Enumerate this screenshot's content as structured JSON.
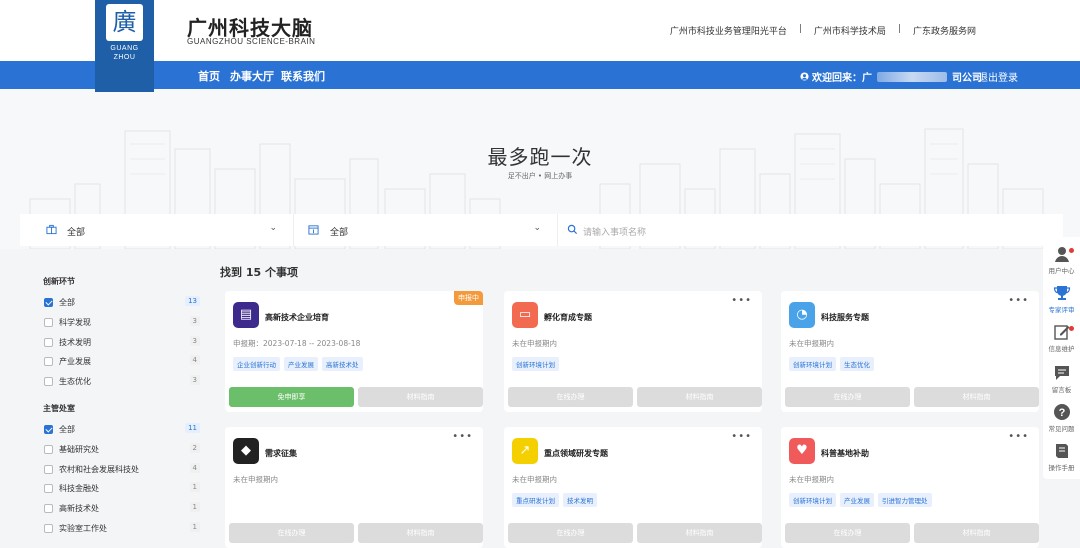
{
  "brand": {
    "logo_char": "廣",
    "logo_en_1": "GUANG",
    "logo_en_2": "ZHOU",
    "title": "广州科技大脑",
    "subtitle": "GUANGZHOU SCIENCE-BRAIN"
  },
  "top_links": [
    "广州市科技业务管理阳光平台",
    "广州市科学技术局",
    "广东政务服务网"
  ],
  "nav": {
    "items": [
      "首页",
      "办事大厅",
      "联系我们"
    ],
    "welcome_prefix": "欢迎回来：广",
    "welcome_suffix": "司公司",
    "logout": "退出登录"
  },
  "hero": {
    "title": "最多跑一次",
    "subtitle": "足不出户 • 网上办事"
  },
  "filters": {
    "category_value": "全部",
    "date_value": "全部",
    "search_placeholder": "请输入事项名称"
  },
  "sidebar": {
    "group1": {
      "title": "创新环节",
      "items": [
        {
          "label": "全部",
          "count": "13",
          "checked": true
        },
        {
          "label": "科学发现",
          "count": "3",
          "checked": false
        },
        {
          "label": "技术发明",
          "count": "3",
          "checked": false
        },
        {
          "label": "产业发展",
          "count": "4",
          "checked": false
        },
        {
          "label": "生态优化",
          "count": "3",
          "checked": false
        }
      ]
    },
    "group2": {
      "title": "主管处室",
      "items": [
        {
          "label": "全部",
          "count": "11",
          "checked": true
        },
        {
          "label": "基础研究处",
          "count": "2",
          "checked": false
        },
        {
          "label": "农村和社会发展科技处",
          "count": "4",
          "checked": false
        },
        {
          "label": "科技金融处",
          "count": "1",
          "checked": false
        },
        {
          "label": "高新技术处",
          "count": "1",
          "checked": false
        },
        {
          "label": "实验室工作处",
          "count": "1",
          "checked": false
        }
      ]
    }
  },
  "results": {
    "text": "找到 15 个事项"
  },
  "cards": [
    {
      "title": "高新技术企业培育",
      "period": "申报期：2023-07-18 -- 2023-08-18",
      "tags": [
        "企业创新行动",
        "产业发展",
        "高新技术处"
      ],
      "btn_left": "免申即享",
      "btn_right": "材料指南",
      "badge": "申报中",
      "icon_color": "#3d2a8c"
    },
    {
      "title": "孵化育成专题",
      "period": "未在申报期内",
      "tags": [
        "创新环境计划"
      ],
      "btn_left": "在线办理",
      "btn_right": "材料指南",
      "badge": "",
      "icon_color": "#f26a4f"
    },
    {
      "title": "科技服务专题",
      "period": "未在申报期内",
      "tags": [
        "创新环境计划",
        "生态优化"
      ],
      "btn_left": "在线办理",
      "btn_right": "材料指南",
      "badge": "",
      "icon_color": "#4aa3e8"
    },
    {
      "title": "需求征集",
      "period": "未在申报期内",
      "tags": [],
      "btn_left": "在线办理",
      "btn_right": "材料指南",
      "badge": "",
      "icon_color": "#222222"
    },
    {
      "title": "重点领域研发专题",
      "period": "未在申报期内",
      "tags": [
        "重点研发计划",
        "技术发明"
      ],
      "btn_left": "在线办理",
      "btn_right": "材料指南",
      "badge": "",
      "icon_color": "#f5d000"
    },
    {
      "title": "科普基地补助",
      "period": "未在申报期内",
      "tags": [
        "创新环境计划",
        "产业发展",
        "引进智力管理处"
      ],
      "btn_left": "在线办理",
      "btn_right": "材料指南",
      "badge": "",
      "icon_color": "#f05a5a"
    }
  ],
  "rail": [
    {
      "label": "用户中心",
      "icon": "user-icon",
      "dot": true
    },
    {
      "label": "专家评审",
      "icon": "trophy-icon",
      "dot": false
    },
    {
      "label": "信息维护",
      "icon": "edit-icon",
      "dot": true
    },
    {
      "label": "留言板",
      "icon": "message-icon",
      "dot": false
    },
    {
      "label": "常见问题",
      "icon": "question-icon",
      "dot": false
    },
    {
      "label": "操作手册",
      "icon": "book-icon",
      "dot": false
    }
  ]
}
